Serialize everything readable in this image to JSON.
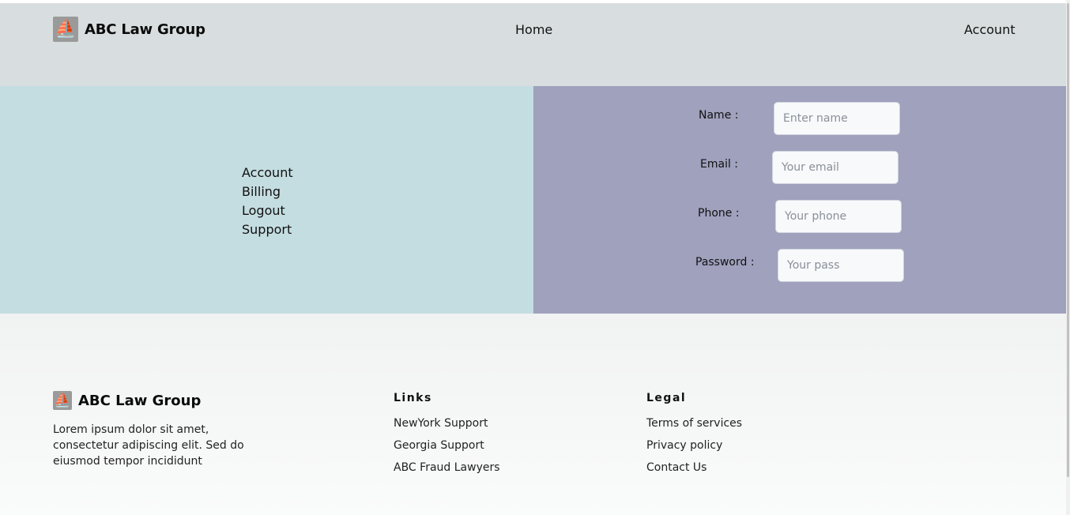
{
  "header": {
    "brand_name": "ABC Law Group",
    "logo_icon": "ship-icon",
    "nav": {
      "home": "Home",
      "account": "Account"
    }
  },
  "sidebar": {
    "items": [
      {
        "label": "Account"
      },
      {
        "label": "Billing"
      },
      {
        "label": "Logout"
      },
      {
        "label": "Support"
      }
    ]
  },
  "form": {
    "name": {
      "label": "Name :",
      "placeholder": "Enter name",
      "value": ""
    },
    "email": {
      "label": "Email :",
      "placeholder": "Your email",
      "value": ""
    },
    "phone": {
      "label": "Phone :",
      "placeholder": "Your phone",
      "value": ""
    },
    "password": {
      "label": "Password :",
      "placeholder": "Your pass",
      "value": ""
    }
  },
  "footer": {
    "brand_name": "ABC Law Group",
    "description": "Lorem ipsum dolor sit amet, consectetur adipiscing elit. Sed do eiusmod tempor incididunt",
    "links": {
      "title": "Links",
      "items": [
        {
          "label": "NewYork Support"
        },
        {
          "label": "Georgia Support"
        },
        {
          "label": "ABC Fraud Lawyers"
        }
      ]
    },
    "legal": {
      "title": "Legal",
      "items": [
        {
          "label": "Terms of services"
        },
        {
          "label": "Privacy policy"
        },
        {
          "label": "Contact Us"
        }
      ]
    }
  },
  "colors": {
    "header_bg": "#d8dedf",
    "left_panel_bg": "#c4dde1",
    "right_panel_bg": "#9fa1bd",
    "footer_bg": "#f4f5f5"
  }
}
